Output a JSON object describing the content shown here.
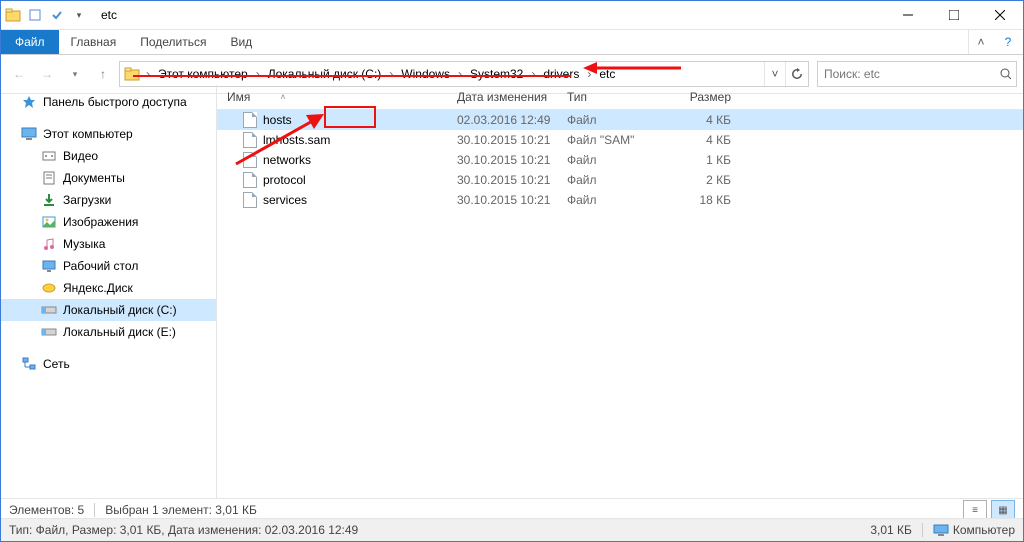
{
  "window_title": "etc",
  "ribbon": {
    "file": "Файл",
    "tabs": [
      "Главная",
      "Поделиться",
      "Вид"
    ]
  },
  "breadcrumbs": [
    "Этот компьютер",
    "Локальный диск (C:)",
    "Windows",
    "System32",
    "drivers",
    "etc"
  ],
  "search_placeholder": "Поиск: etc",
  "nav": {
    "quick_access": "Панель быстрого доступа",
    "this_pc": "Этот компьютер",
    "this_pc_children": [
      {
        "icon": "video",
        "label": "Видео"
      },
      {
        "icon": "doc",
        "label": "Документы"
      },
      {
        "icon": "download",
        "label": "Загрузки"
      },
      {
        "icon": "image",
        "label": "Изображения"
      },
      {
        "icon": "music",
        "label": "Музыка"
      },
      {
        "icon": "desktop",
        "label": "Рабочий стол"
      },
      {
        "icon": "yadisk",
        "label": "Яндекс.Диск"
      },
      {
        "icon": "drive",
        "label": "Локальный диск (C:)"
      },
      {
        "icon": "drive",
        "label": "Локальный диск (E:)"
      }
    ],
    "network": "Сеть"
  },
  "columns": {
    "name": "Имя",
    "date": "Дата изменения",
    "type": "Тип",
    "size": "Размер"
  },
  "files": [
    {
      "name": "hosts",
      "date": "02.03.2016 12:49",
      "type": "Файл",
      "size": "4 КБ",
      "selected": true
    },
    {
      "name": "lmhosts.sam",
      "date": "30.10.2015 10:21",
      "type": "Файл \"SAM\"",
      "size": "4 КБ",
      "selected": false
    },
    {
      "name": "networks",
      "date": "30.10.2015 10:21",
      "type": "Файл",
      "size": "1 КБ",
      "selected": false
    },
    {
      "name": "protocol",
      "date": "30.10.2015 10:21",
      "type": "Файл",
      "size": "2 КБ",
      "selected": false
    },
    {
      "name": "services",
      "date": "30.10.2015 10:21",
      "type": "Файл",
      "size": "18 КБ",
      "selected": false
    }
  ],
  "status_inner": {
    "count_label": "Элементов: 5",
    "selection_label": "Выбран 1 элемент: 3,01 КБ"
  },
  "status_outer": {
    "tip": "Тип: Файл, Размер: 3,01 КБ, Дата изменения: 02.03.2016 12:49",
    "size": "3,01 КБ",
    "location": "Компьютер"
  }
}
